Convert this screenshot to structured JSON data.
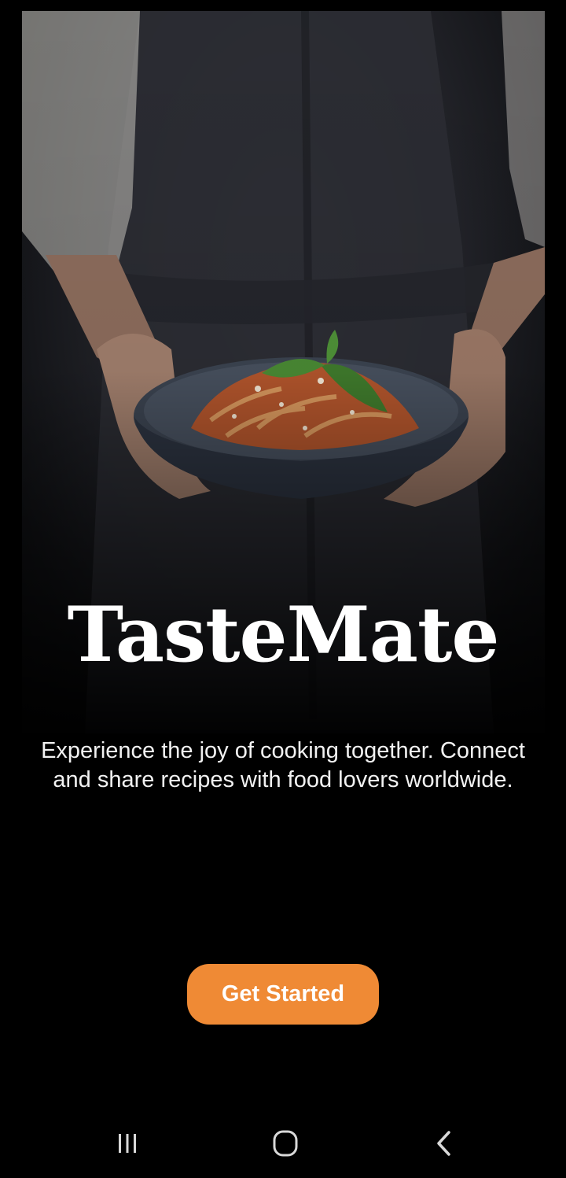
{
  "app": {
    "title": "TasteMate",
    "tagline": "Experience the joy of cooking together. Connect and share recipes with food lovers worldwide.",
    "cta_label": "Get Started"
  },
  "hero": {
    "image": "chef holding bowl of pasta with basil"
  },
  "colors": {
    "accent": "#ef8a35",
    "background": "#000000",
    "text": "#ffffff"
  },
  "navbar": {
    "recents_icon": "recents-icon",
    "home_icon": "home-icon",
    "back_icon": "back-icon"
  }
}
